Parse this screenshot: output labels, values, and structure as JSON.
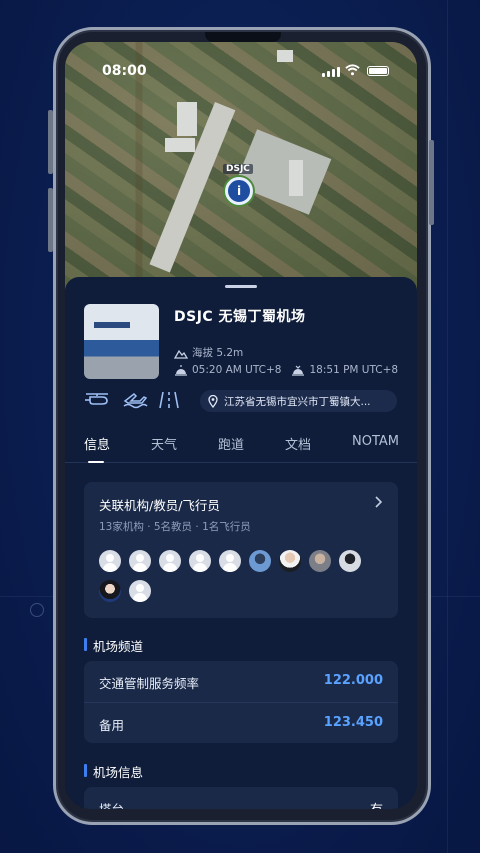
{
  "status_bar": {
    "time": "08:00"
  },
  "map": {
    "marker_code": "DSJC",
    "marker_glyph": "i"
  },
  "airport": {
    "title": "DSJC 无锡丁蜀机场",
    "elevation": "海拔 5.2m",
    "sunrise": "05:20 AM UTC+8",
    "sunset": "18:51 PM UTC+8",
    "address": "江苏省无锡市宜兴市丁蜀镇大..."
  },
  "feature_icons": [
    "helicopter-icon",
    "seaplane-icon",
    "runway-icon"
  ],
  "tabs": [
    {
      "label": "信息",
      "active": true
    },
    {
      "label": "天气",
      "active": false
    },
    {
      "label": "跑道",
      "active": false
    },
    {
      "label": "文档",
      "active": false
    },
    {
      "label": "NOTAM",
      "active": false
    }
  ],
  "related": {
    "title": "关联机构/教员/飞行员",
    "summary": "13家机构 · 5名教员 · 1名飞行员",
    "avatars": [
      "placeholder",
      "placeholder",
      "placeholder",
      "placeholder",
      "placeholder",
      "photo",
      "photo",
      "photo",
      "photo",
      "photo",
      "placeholder"
    ]
  },
  "frequencies": {
    "section_title": "机场频道",
    "rows": [
      {
        "label": "交通管制服务频率",
        "value": "122.000"
      },
      {
        "label": "备用",
        "value": "123.450"
      }
    ]
  },
  "airport_info": {
    "section_title": "机场信息",
    "rows": [
      {
        "label": "塔台",
        "value": "有"
      }
    ]
  },
  "colors": {
    "accent": "#5aa2ff",
    "sheet_bg": "#0f1d3a",
    "card_bg": "#1a2948"
  }
}
